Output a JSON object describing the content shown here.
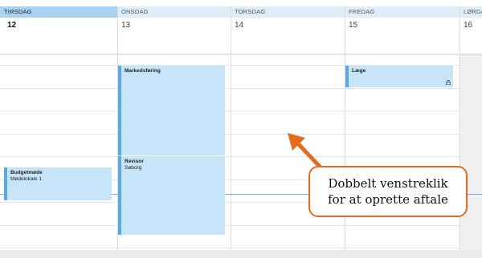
{
  "days": [
    {
      "name": "TIRSDAG",
      "number": "12",
      "today": true
    },
    {
      "name": "ONSDAG",
      "number": "13",
      "today": false
    },
    {
      "name": "TORSDAG",
      "number": "14",
      "today": false
    },
    {
      "name": "FREDAG",
      "number": "15",
      "today": false
    },
    {
      "name": "LØRDAG",
      "number": "16",
      "today": false
    }
  ],
  "events": [
    {
      "id": "markedsforing",
      "title": "Markedsføring",
      "location": ""
    },
    {
      "id": "revisor",
      "title": "Revisor",
      "location": "Søborg"
    },
    {
      "id": "laege",
      "title": "Læge",
      "location": "",
      "icon": "lock-icon"
    },
    {
      "id": "budgetmode",
      "title": "Budgetmøde",
      "location": "Mødelokale 1"
    }
  ],
  "callout": {
    "line1": "Dobbelt venstreklik",
    "line2": "for at oprette aftale"
  },
  "colors": {
    "event_fill": "#c7e5f8",
    "event_bar": "#5aa9e6",
    "today_header": "#a8d1f2",
    "callout_accent": "#e86a1f",
    "now_line": "#6aaee5"
  }
}
